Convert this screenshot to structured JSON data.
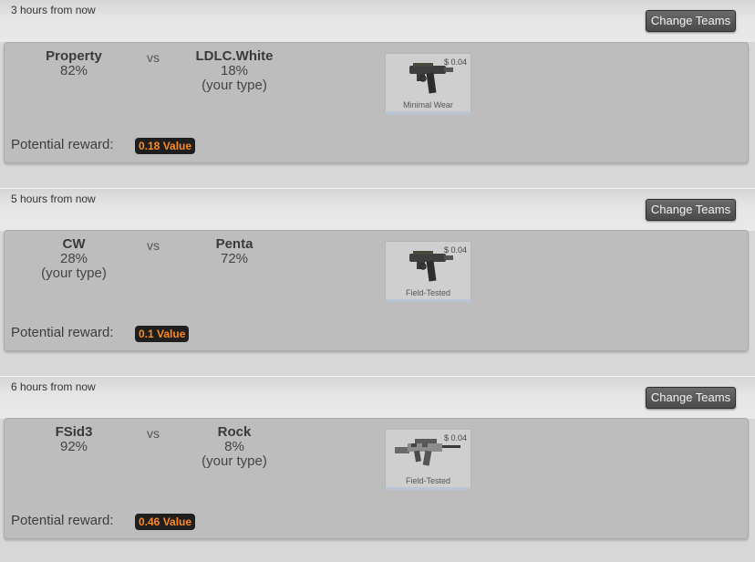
{
  "matches": [
    {
      "time": "3 hours from now",
      "change_label": "Change Teams",
      "team_left": {
        "name": "Property",
        "pct": "82%",
        "note": ""
      },
      "vs": "vs",
      "team_right": {
        "name": "LDLC.White",
        "pct": "18%",
        "note": "(your type)"
      },
      "item": {
        "price": "$ 0.04",
        "wear": "Minimal Wear",
        "icon": "pistol-icon"
      },
      "reward_label": "Potential reward:",
      "reward_value": "0.18 Value"
    },
    {
      "time": "5 hours from now",
      "change_label": "Change Teams",
      "team_left": {
        "name": "CW",
        "pct": "28%",
        "note": "(your type)"
      },
      "vs": "vs",
      "team_right": {
        "name": "Penta",
        "pct": "72%",
        "note": ""
      },
      "item": {
        "price": "$ 0.04",
        "wear": "Field-Tested",
        "icon": "pistol-icon"
      },
      "reward_label": "Potential reward:",
      "reward_value": "0.1 Value"
    },
    {
      "time": "6 hours from now",
      "change_label": "Change Teams",
      "team_left": {
        "name": "FSid3",
        "pct": "92%",
        "note": ""
      },
      "vs": "vs",
      "team_right": {
        "name": "Rock",
        "pct": "8%",
        "note": "(your type)"
      },
      "item": {
        "price": "$ 0.04",
        "wear": "Field-Tested",
        "icon": "rifle-icon"
      },
      "reward_label": "Potential reward:",
      "reward_value": "0.46 Value"
    }
  ],
  "colors": {
    "reward_text": "#ff8a1c",
    "reward_bg": "#1f1f1f",
    "panel_bg": "#bdbdbd"
  }
}
